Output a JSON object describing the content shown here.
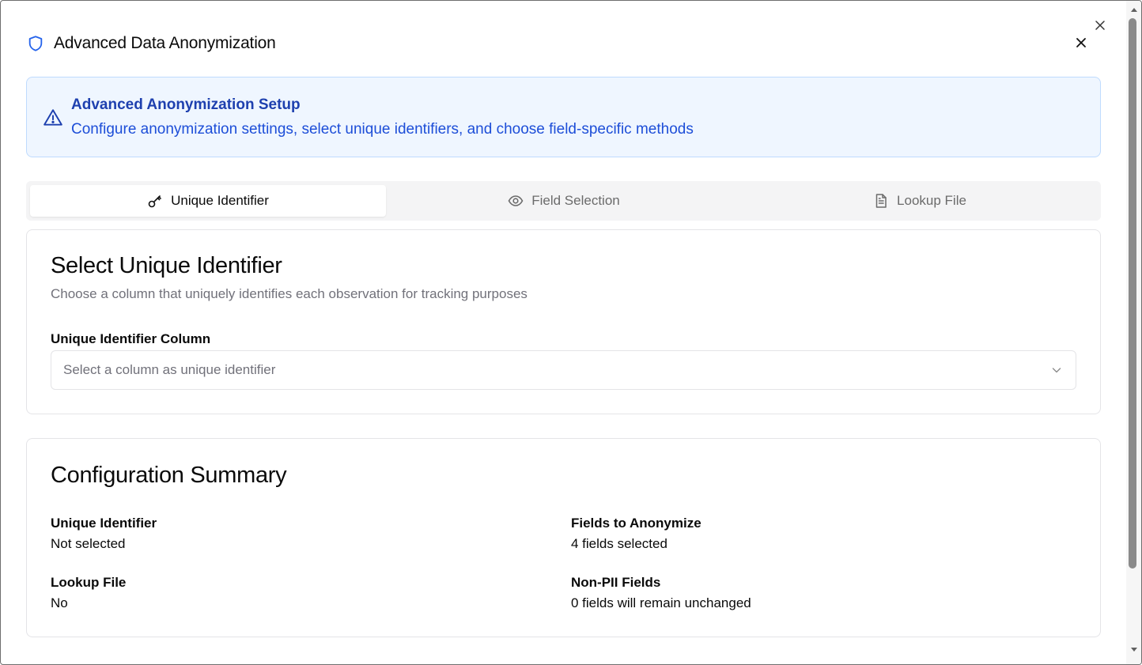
{
  "dialog": {
    "title": "Advanced Data Anonymization",
    "header_icon": "shield-icon",
    "close_icon": "close-icon"
  },
  "alert": {
    "title": "Advanced Anonymization Setup",
    "description": "Configure anonymization settings, select unique identifiers, and choose field-specific methods",
    "icon": "warning-triangle-icon",
    "colors": {
      "background": "#eff6ff",
      "border": "#bfdbfe",
      "title": "#1e40af",
      "text": "#1d4ed8"
    }
  },
  "tabs": [
    {
      "label": "Unique Identifier",
      "icon": "key-icon",
      "active": true
    },
    {
      "label": "Field Selection",
      "icon": "eye-icon",
      "active": false
    },
    {
      "label": "Lookup File",
      "icon": "file-text-icon",
      "active": false
    }
  ],
  "identifier_card": {
    "title": "Select Unique Identifier",
    "description": "Choose a column that uniquely identifies each observation for tracking purposes",
    "field_label": "Unique Identifier Column",
    "select_placeholder": "Select a column as unique identifier",
    "select_icon": "chevron-down-icon"
  },
  "summary_card": {
    "title": "Configuration Summary",
    "items": [
      {
        "label": "Unique Identifier",
        "value": "Not selected"
      },
      {
        "label": "Fields to Anonymize",
        "value": "4 fields selected"
      },
      {
        "label": "Lookup File",
        "value": "No"
      },
      {
        "label": "Non-PII Fields",
        "value": "0 fields will remain unchanged"
      }
    ]
  }
}
